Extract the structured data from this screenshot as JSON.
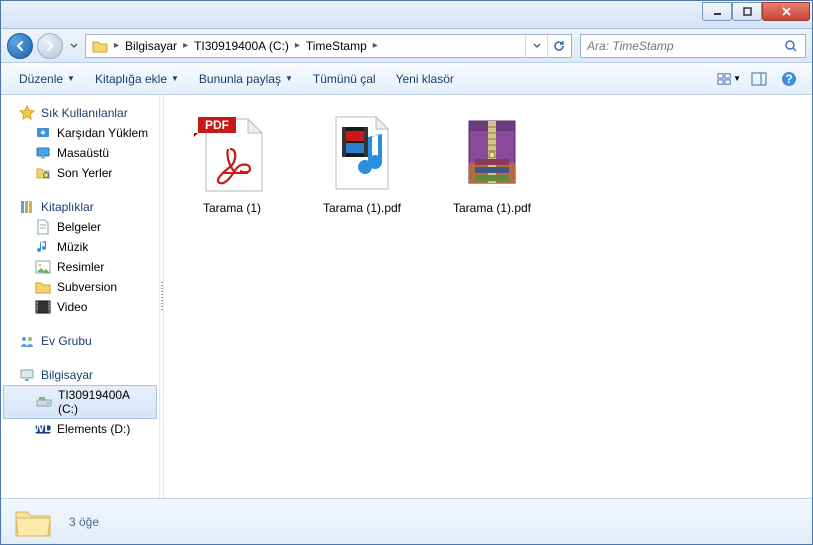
{
  "breadcrumb": {
    "root_arrow": "▸",
    "items": [
      "Bilgisayar",
      "TI30919400A (C:)",
      "TimeStamp"
    ]
  },
  "search": {
    "placeholder": "Ara: TimeStamp"
  },
  "toolbar": {
    "organize": "Düzenle",
    "add_library": "Kitaplığa ekle",
    "share_with": "Bununla paylaş",
    "play_all": "Tümünü çal",
    "new_folder": "Yeni klasör"
  },
  "sidebar": {
    "favorites": {
      "label": "Sık Kullanılanlar",
      "items": [
        {
          "label": "Karşıdan Yüklem"
        },
        {
          "label": "Masaüstü"
        },
        {
          "label": "Son Yerler"
        }
      ]
    },
    "libraries": {
      "label": "Kitaplıklar",
      "items": [
        {
          "label": "Belgeler"
        },
        {
          "label": "Müzik"
        },
        {
          "label": "Resimler"
        },
        {
          "label": "Subversion"
        },
        {
          "label": "Video"
        }
      ]
    },
    "homegroup": {
      "label": "Ev Grubu"
    },
    "computer": {
      "label": "Bilgisayar",
      "items": [
        {
          "label": "TI30919400A (C:)",
          "selected": true
        },
        {
          "label": "Elements (D:)"
        }
      ]
    }
  },
  "files": [
    {
      "name": "Tarama (1)",
      "type": "pdf"
    },
    {
      "name": "Tarama (1).pdf",
      "type": "media"
    },
    {
      "name": "Tarama (1).pdf",
      "type": "rar"
    }
  ],
  "status": {
    "count_text": "3 öğe"
  }
}
